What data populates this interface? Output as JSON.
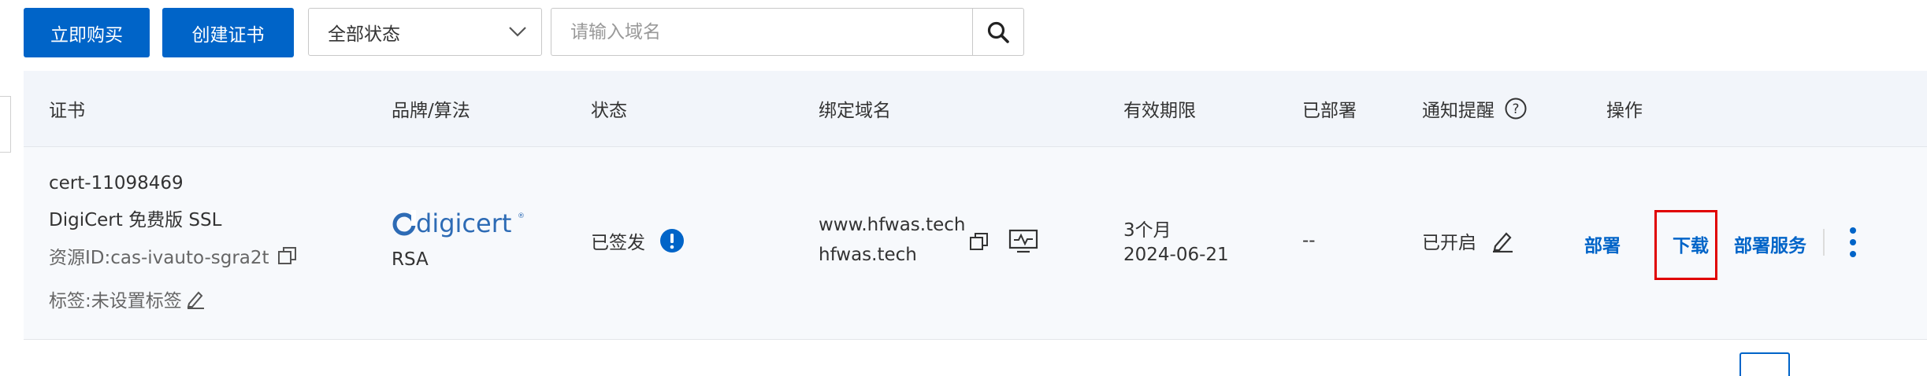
{
  "toolbar": {
    "buy_label": "立即购买",
    "create_label": "创建证书",
    "status_select_value": "全部状态",
    "search_placeholder": "请输入域名"
  },
  "table": {
    "headers": {
      "cert": "证书",
      "brand": "品牌/算法",
      "status": "状态",
      "domain": "绑定域名",
      "validity": "有效期限",
      "deployed": "已部署",
      "notify": "通知提醒",
      "actions": "操作"
    },
    "row": {
      "cert_name": "cert-11098469",
      "cert_product": "DigiCert 免费版 SSL",
      "resource_id": "资源ID:cas-ivauto-sgra2t",
      "tag_label": "标签:未设置标签",
      "brand_logo_text": "digicert",
      "algorithm": "RSA",
      "status": "已签发",
      "domain_1": "www.hfwas.tech",
      "domain_2": "hfwas.tech",
      "validity_period": "3个月",
      "validity_date": "2024-06-21",
      "deployed": "--",
      "notify_status": "已开启",
      "action_deploy": "部署",
      "action_download": "下载",
      "action_deploy_service": "部署服务"
    }
  },
  "colors": {
    "primary": "#0064c8",
    "header_bg": "#f2f5fa",
    "row_bg": "#f7f9fc",
    "highlight": "#e00000",
    "digicert_blue": "#2d6bb5"
  },
  "icons": [
    "chevron-down-icon",
    "search-icon",
    "help-icon",
    "copy-icon",
    "monitor-icon",
    "info-icon",
    "edit-icon",
    "more-vertical-icon"
  ]
}
